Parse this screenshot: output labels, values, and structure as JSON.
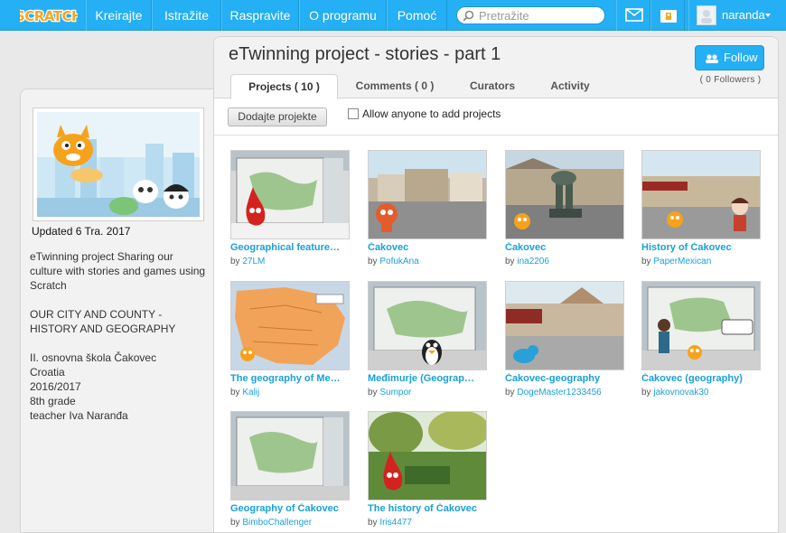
{
  "nav": {
    "logo_text": "SCRATCH",
    "items": [
      "Kreirajte",
      "Istražite",
      "Raspravite",
      "O programu",
      "Pomoć"
    ],
    "search_placeholder": "Pretražite",
    "username": "naranda"
  },
  "sidebar": {
    "updated": "Updated 6 Tra. 2017",
    "description": "eTwinning project Sharing our culture with stories and games using Scratch\n\nOUR CITY AND COUNTY - HISTORY AND GEOGRAPHY\n\nII. osnovna škola Čakovec\nCroatia\n2016/2017\n8th grade\nteacher Iva Naranđa"
  },
  "studio": {
    "title": "eTwinning project - stories - part 1",
    "follow_label": "Follow",
    "followers": "( 0 Followers )",
    "tabs": [
      "Projects ( 10 )",
      "Comments ( 0 )",
      "Curators",
      "Activity"
    ],
    "add_button": "Dodajte projekte",
    "allow_label": "Allow anyone to add projects"
  },
  "projects": [
    {
      "title": "Geographical feature…",
      "by_prefix": "by",
      "author": "27LM"
    },
    {
      "title": "Čakovec",
      "by_prefix": "by",
      "author": "PofukAna"
    },
    {
      "title": "Čakovec",
      "by_prefix": "by",
      "author": "ina2206"
    },
    {
      "title": "History of Čakovec",
      "by_prefix": "by",
      "author": "PaperMexican"
    },
    {
      "title": "The geography of Me…",
      "by_prefix": "by",
      "author": "Kalij"
    },
    {
      "title": "Međimurje (Geograp…",
      "by_prefix": "by",
      "author": "Sumpor"
    },
    {
      "title": "Čakovec-geography",
      "by_prefix": "by",
      "author": "DogeMaster1233456"
    },
    {
      "title": "Čakovec (geography)",
      "by_prefix": "by",
      "author": "jakovnovak30"
    },
    {
      "title": "Geography of Čakovec",
      "by_prefix": "by",
      "author": "BimboChallenger"
    },
    {
      "title": "The history of Čakovec",
      "by_prefix": "by",
      "author": "Iris4477"
    }
  ],
  "colors": {
    "brand": "#25aff4",
    "link": "#1aa0d8"
  }
}
